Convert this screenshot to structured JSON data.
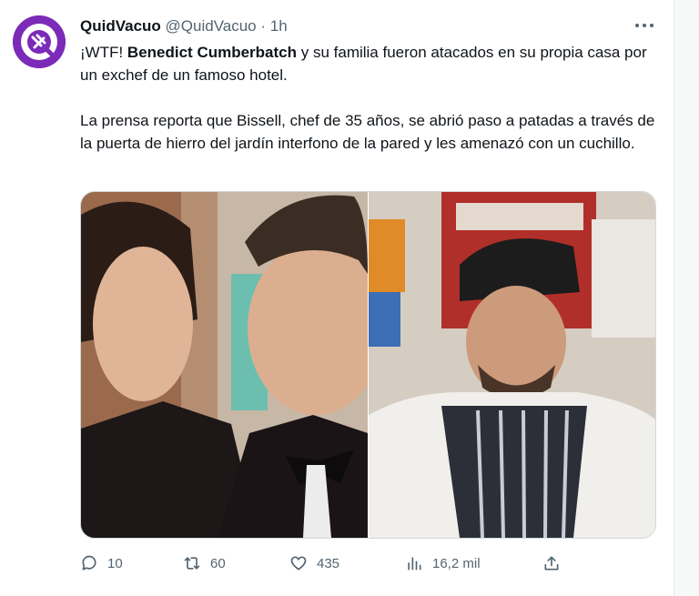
{
  "author": {
    "name": "QuidVacuo",
    "handle": "@QuidVacuo",
    "separator": "·",
    "time": "1h"
  },
  "tweet": {
    "p1_prefix": "¡WTF! ",
    "p1_bold": "Benedict Cumberbatch",
    "p1_rest": " y su familia fueron atacados en su propia casa por un exchef de un famoso hotel.",
    "p2": "La prensa reporta que Bissell, chef de 35 años, se abrió paso a patadas a través de la puerta de hierro del jardín interfono de la pared y les amenazó con un cuchillo."
  },
  "more_icon": "more-horizontal-icon",
  "actions": {
    "replies": "10",
    "retweets": "60",
    "likes": "435",
    "views": "16,2 mil"
  },
  "colors": {
    "text": "#0f1419",
    "secondary": "#536471",
    "avatar": "#7c2ab8"
  }
}
